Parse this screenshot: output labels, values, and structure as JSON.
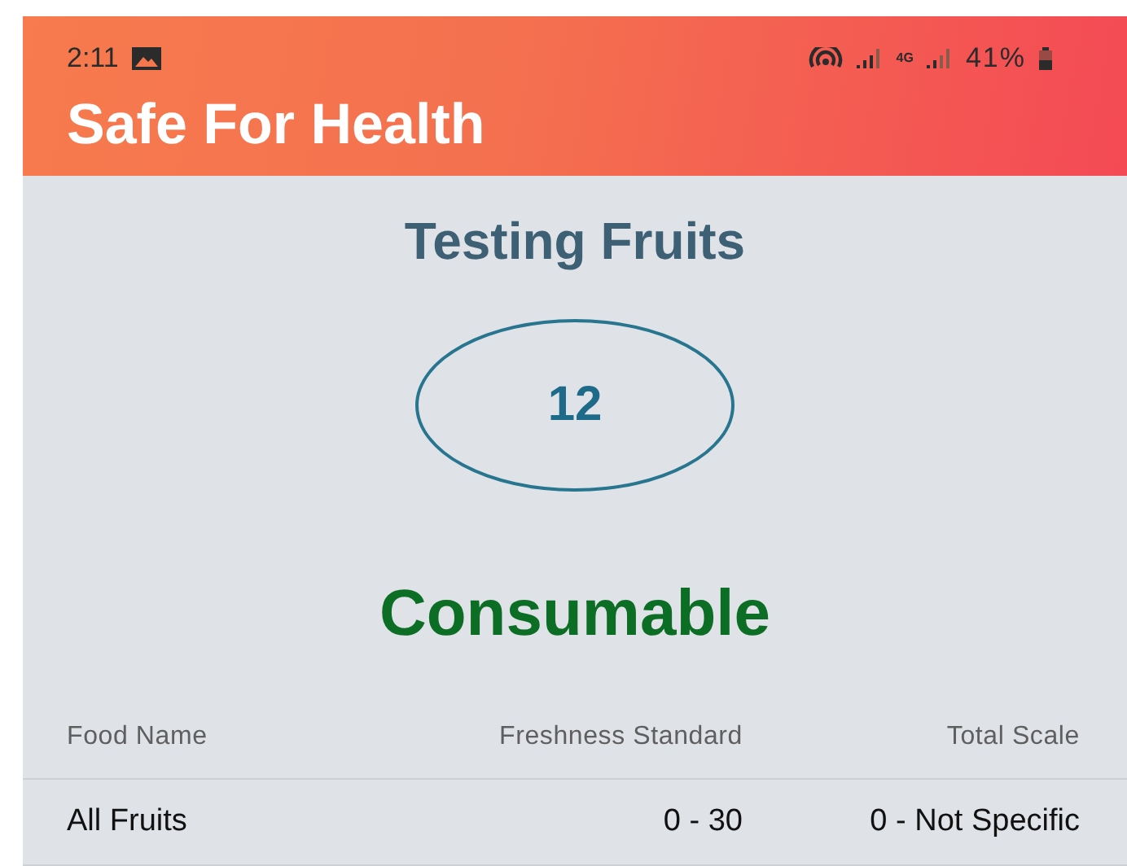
{
  "status_bar": {
    "time": "2:11",
    "network": "4G",
    "battery": "41%"
  },
  "app_bar": {
    "title": "Safe For Health"
  },
  "test": {
    "title": "Testing Fruits",
    "score": "12",
    "verdict": "Consumable"
  },
  "table": {
    "columns": [
      "Food Name",
      "Freshness Standard",
      "Total Scale"
    ],
    "rows": [
      [
        "All Fruits",
        "0 - 30",
        "0 - Not Specific"
      ]
    ]
  }
}
